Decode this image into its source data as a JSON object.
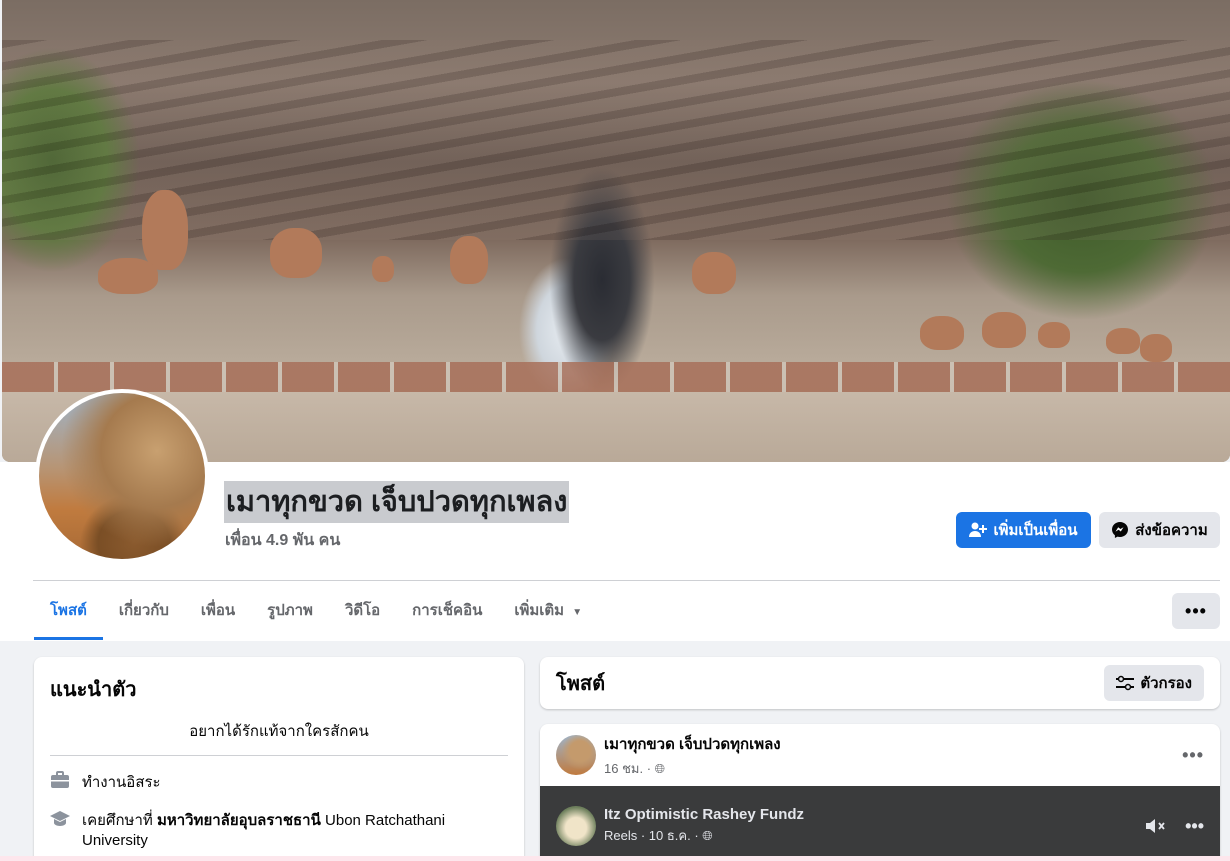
{
  "profile": {
    "name": "เมาทุกขวด เจ็บปวดทุกเพลง",
    "friends": "เพื่อน 4.9 พัน คน"
  },
  "actions": {
    "add_friend": "เพิ่มเป็นเพื่อน",
    "message": "ส่งข้อความ",
    "more": "•••"
  },
  "tabs": [
    {
      "label": "โพสต์"
    },
    {
      "label": "เกี่ยวกับ"
    },
    {
      "label": "เพื่อน"
    },
    {
      "label": "รูปภาพ"
    },
    {
      "label": "วิดีโอ"
    },
    {
      "label": "การเช็คอิน"
    },
    {
      "label": "เพิ่มเติม"
    }
  ],
  "intro": {
    "title": "แนะนำตัว",
    "bio": "อยากได้รักแท้จากใครสักคน",
    "work": "ทำงานอิสระ",
    "education_prefix": "เคยศึกษาที่",
    "education_school": "มหาวิทยาลัยอุบลราชธานี",
    "education_rest": "Ubon Ratchathani University"
  },
  "posts": {
    "title": "โพสต์",
    "filter_label": "ตัวกรอง",
    "post": {
      "author": "เมาทุกขวด เจ็บปวดทุกเพลง",
      "time": "16 ชม. ·",
      "shared": {
        "author": "Itz Optimistic Rashey Fundz",
        "meta": "Reels · 10 ธ.ค. ·"
      }
    }
  },
  "colors": {
    "accent": "#1b74e4",
    "secondary_button": "#e4e6eb",
    "background": "#f0f2f5"
  }
}
